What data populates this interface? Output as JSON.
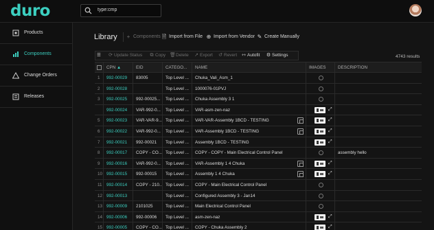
{
  "brand": {
    "logo": "duro"
  },
  "search": {
    "query": "type:cmp"
  },
  "sidebar": {
    "items": [
      {
        "label": "Products",
        "icon": "products-icon",
        "active": false
      },
      {
        "label": "Components",
        "icon": "components-icon",
        "active": true
      },
      {
        "label": "Change Orders",
        "icon": "change-orders-icon",
        "active": false
      },
      {
        "label": "Releases",
        "icon": "releases-icon",
        "active": false
      }
    ]
  },
  "library": {
    "title": "Library",
    "actions": {
      "components": "Components",
      "import_file": "Import from File",
      "import_vendor": "Import from Vendor",
      "create": "Create Manually"
    },
    "toolbar": {
      "update_status": "Update Status",
      "copy": "Copy",
      "delete": "Delete",
      "export": "Export",
      "revert": "Revert",
      "autofit": "Autofit",
      "settings": "Settings"
    },
    "result_count": "4743 results"
  },
  "table": {
    "headers": {
      "cpn": "CPN",
      "eid": "EID",
      "category": "CATEGO...",
      "name": "NAME",
      "images": "IMAGES",
      "description": "DESCRIPTION"
    },
    "rows": [
      {
        "n": "1",
        "cpn": "992-00029",
        "eid": "83005",
        "cat": "Top Level ...",
        "name": "Chuka_Vali_Asm_1",
        "img": "none",
        "chip": false,
        "desc": ""
      },
      {
        "n": "2",
        "cpn": "992-00028",
        "eid": "",
        "cat": "Top Level ...",
        "name": "1000076-01PVJ",
        "img": "none",
        "chip": false,
        "desc": ""
      },
      {
        "n": "3",
        "cpn": "992-00025",
        "eid": "992-00025...",
        "cat": "Top Level ...",
        "name": "Chuka Assembly 3 1",
        "img": "none",
        "chip": false,
        "desc": ""
      },
      {
        "n": "",
        "cpn": "992-00024",
        "eid": "VAR-992-0...",
        "cat": "Top Level ...",
        "name": "VAR-asm-zen-naz",
        "img": "thumb",
        "chip": false,
        "desc": ""
      },
      {
        "n": "5",
        "cpn": "992-00023",
        "eid": "VAR-VAR-9...",
        "cat": "Top Level ...",
        "name": "VAR-VAR-Assembly 1BCD - TESTING",
        "img": "thumb",
        "chip": true,
        "desc": ""
      },
      {
        "n": "6",
        "cpn": "992-00022",
        "eid": "VAR-992-0...",
        "cat": "Top Level ...",
        "name": "VAR-Assembly 1BCD - TESTING",
        "img": "thumb",
        "chip": true,
        "desc": ""
      },
      {
        "n": "7",
        "cpn": "992-00021",
        "eid": "992-00021",
        "cat": "Top Level ...",
        "name": "Assembly 1BCD - TESTING",
        "img": "thumb",
        "chip": false,
        "desc": ""
      },
      {
        "n": "8",
        "cpn": "992-00017",
        "eid": "COPY - CO...",
        "cat": "Top Level ...",
        "name": "COPY - COPY - Main Electrical Control Panel",
        "img": "none",
        "chip": false,
        "desc": "assembly hello"
      },
      {
        "n": "9",
        "cpn": "992-00016",
        "eid": "VAR-992-0...",
        "cat": "Top Level ...",
        "name": "VAR-Assembly 1 4 Chuka",
        "img": "thumb",
        "chip": true,
        "desc": ""
      },
      {
        "n": "10",
        "cpn": "992-00015",
        "eid": "992-00015",
        "cat": "Top Level ...",
        "name": "Assembly 1 4 Chuka",
        "img": "thumb",
        "chip": true,
        "desc": ""
      },
      {
        "n": "11",
        "cpn": "992-00014",
        "eid": "COPY - 210...",
        "cat": "Top Level ...",
        "name": "COPY - Main Electrical Control Panel",
        "img": "none",
        "chip": false,
        "desc": ""
      },
      {
        "n": "12",
        "cpn": "992-00013",
        "eid": "",
        "cat": "Top Level ...",
        "name": "Configured Assembly 3 - Jan14",
        "img": "none",
        "chip": false,
        "desc": ""
      },
      {
        "n": "13",
        "cpn": "992-00009",
        "eid": "2101025",
        "cat": "Top Level ...",
        "name": "Main Electrical Control Panel",
        "img": "none",
        "chip": false,
        "desc": ""
      },
      {
        "n": "14",
        "cpn": "992-00006",
        "eid": "992-00006",
        "cat": "Top Level ...",
        "name": "asm-zen-naz",
        "img": "thumb",
        "chip": false,
        "desc": ""
      },
      {
        "n": "15",
        "cpn": "992-00005",
        "eid": "COPY - CO...",
        "cat": "Top Level ...",
        "name": "COPY - Chuka Assembly 2",
        "img": "thumb",
        "chip": false,
        "desc": ""
      }
    ]
  },
  "colors": {
    "accent": "#3ccfc0",
    "background": "#141414"
  }
}
